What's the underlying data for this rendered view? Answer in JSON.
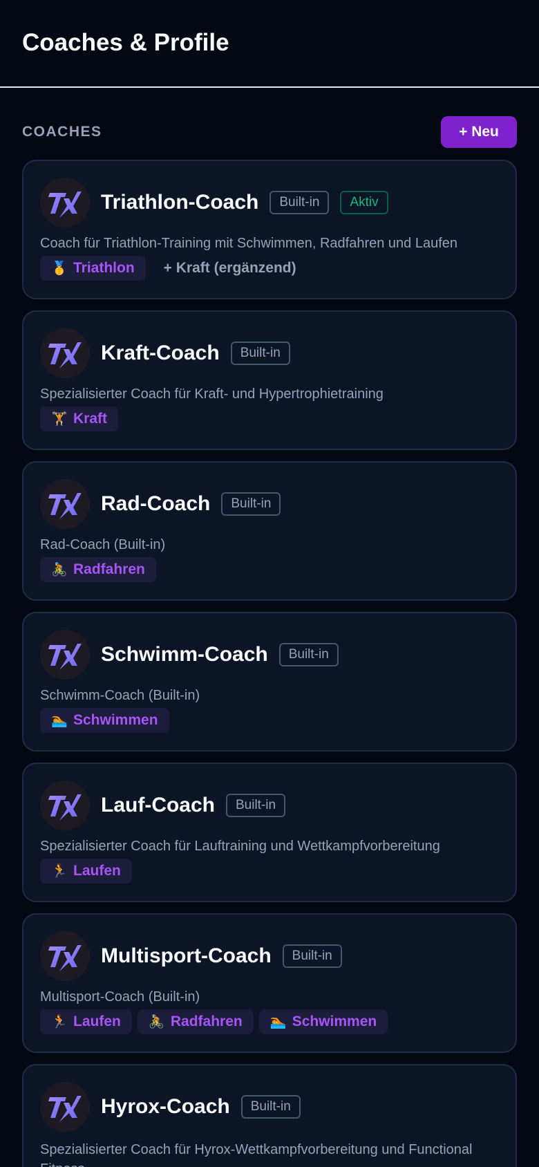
{
  "header": {
    "title": "Coaches & Profile"
  },
  "section": {
    "title": "COACHES",
    "new_button": "+ Neu"
  },
  "colors": {
    "accent": "#7e22ce",
    "tag_text": "#a855f7",
    "active": "#10b981"
  },
  "coaches": [
    {
      "name": "Triathlon-Coach",
      "badges": [
        "Built-in",
        "Aktiv"
      ],
      "description": "Coach für Triathlon-Training mit Schwimmen, Radfahren und Laufen",
      "tags": [
        {
          "emoji": "🥇",
          "label": "Triathlon"
        }
      ],
      "extra": "+ Kraft (ergänzend)"
    },
    {
      "name": "Kraft-Coach",
      "badges": [
        "Built-in"
      ],
      "description": "Spezialisierter Coach für Kraft- und Hypertrophietraining",
      "tags": [
        {
          "emoji": "🏋",
          "label": "Kraft"
        }
      ]
    },
    {
      "name": "Rad-Coach",
      "badges": [
        "Built-in"
      ],
      "description": "Rad-Coach (Built-in)",
      "tags": [
        {
          "emoji": "🚴",
          "label": "Radfahren"
        }
      ]
    },
    {
      "name": "Schwimm-Coach",
      "badges": [
        "Built-in"
      ],
      "description": "Schwimm-Coach (Built-in)",
      "tags": [
        {
          "emoji": "🏊",
          "label": "Schwimmen"
        }
      ]
    },
    {
      "name": "Lauf-Coach",
      "badges": [
        "Built-in"
      ],
      "description": "Spezialisierter Coach für Lauftraining und Wettkampfvorbereitung",
      "tags": [
        {
          "emoji": "🏃",
          "label": "Laufen"
        }
      ]
    },
    {
      "name": "Multisport-Coach",
      "badges": [
        "Built-in"
      ],
      "description": "Multisport-Coach (Built-in)",
      "tags": [
        {
          "emoji": "🏃",
          "label": "Laufen"
        },
        {
          "emoji": "🚴",
          "label": "Radfahren"
        },
        {
          "emoji": "🏊",
          "label": "Schwimmen"
        }
      ]
    },
    {
      "name": "Hyrox-Coach",
      "badges": [
        "Built-in"
      ],
      "description": "Spezialisierter Coach für Hyrox-Wettkampfvorbereitung und Functional Fitness",
      "tags": []
    }
  ]
}
